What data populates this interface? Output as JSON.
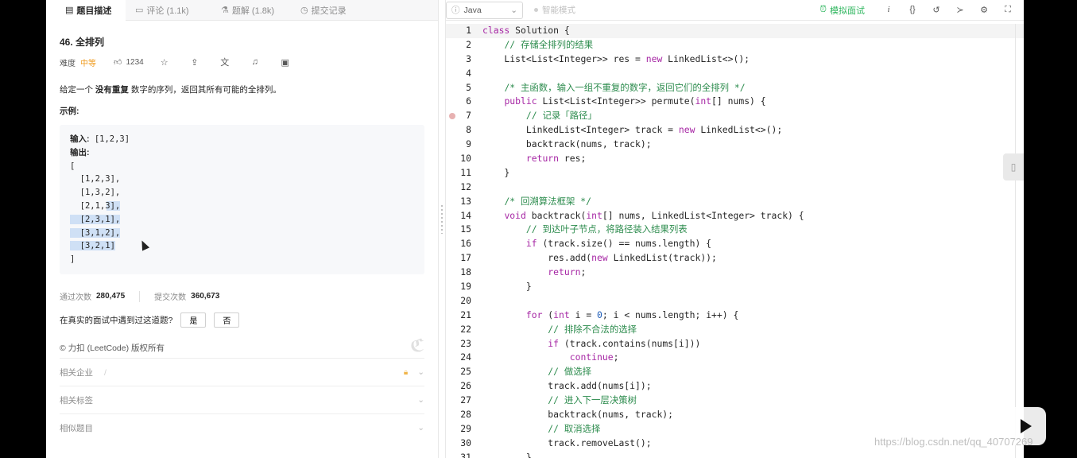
{
  "tabs": [
    {
      "icon": "▤",
      "label": "题目描述"
    },
    {
      "icon": "▭",
      "label": "评论 (1.1k)"
    },
    {
      "icon": "⚗",
      "label": "题解 (1.8k)"
    },
    {
      "icon": "◷",
      "label": "提交记录"
    }
  ],
  "problem": {
    "title": "46. 全排列",
    "difficulty_label": "难度",
    "difficulty": "中等",
    "likes": "1234",
    "desc_prefix": "给定一个 ",
    "desc_bold": "没有重复",
    "desc_suffix": " 数字的序列，返回其所有可能的全排列。",
    "example_label": "示例:",
    "example": {
      "input_label": "输入:",
      "input_value": " [1,2,3]",
      "output_label": "输出:",
      "lines": [
        "[",
        "  [1,2,3],",
        "  [1,3,2],",
        "  [2,1,3],",
        "  [2,3,1],",
        "  [3,1,2],",
        "  [3,2,1]",
        "]"
      ]
    }
  },
  "stats": {
    "accepted_label": "通过次数",
    "accepted": "280,475",
    "submitted_label": "提交次数",
    "submitted": "360,673"
  },
  "interview": {
    "question": "在真实的面试中遇到过这道题?",
    "yes": "是",
    "no": "否"
  },
  "copyright": "© 力扣 (LeetCode) 版权所有",
  "accordions": [
    {
      "label": "相关企业",
      "extra": "/"
    },
    {
      "label": "相关标签"
    },
    {
      "label": "相似题目"
    }
  ],
  "editor": {
    "language": "Java",
    "smart_mode": "智能模式",
    "mock_interview": "模拟面试",
    "icons": [
      "info-icon",
      "braces-icon",
      "reset-icon",
      "console-icon",
      "settings-icon",
      "fullscreen-icon"
    ]
  },
  "code": [
    "class Solution {",
    "    // 存储全排列的结果",
    "    List<List<Integer>> res = new LinkedList<>();",
    "",
    "    /* 主函数，输入一组不重复的数字，返回它们的全排列 */",
    "    public List<List<Integer>> permute(int[] nums) {",
    "        // 记录「路径」",
    "        LinkedList<Integer> track = new LinkedList<>();",
    "        backtrack(nums, track);",
    "        return res;",
    "    }",
    "",
    "    /* 回溯算法框架 */",
    "    void backtrack(int[] nums, LinkedList<Integer> track) {",
    "        // 到达叶子节点，将路径装入结果列表",
    "        if (track.size() == nums.length) {",
    "            res.add(new LinkedList(track));",
    "            return;",
    "        }",
    "",
    "        for (int i = 0; i < nums.length; i++) {",
    "            // 排除不合法的选择",
    "            if (track.contains(nums[i]))",
    "                continue;",
    "            // 做选择",
    "            track.add(nums[i]);",
    "            // 进入下一层决策树",
    "            backtrack(nums, track);",
    "            // 取消选择",
    "            track.removeLast();",
    "        }"
  ],
  "watermark": "https://blog.csdn.net/qq_40707269"
}
